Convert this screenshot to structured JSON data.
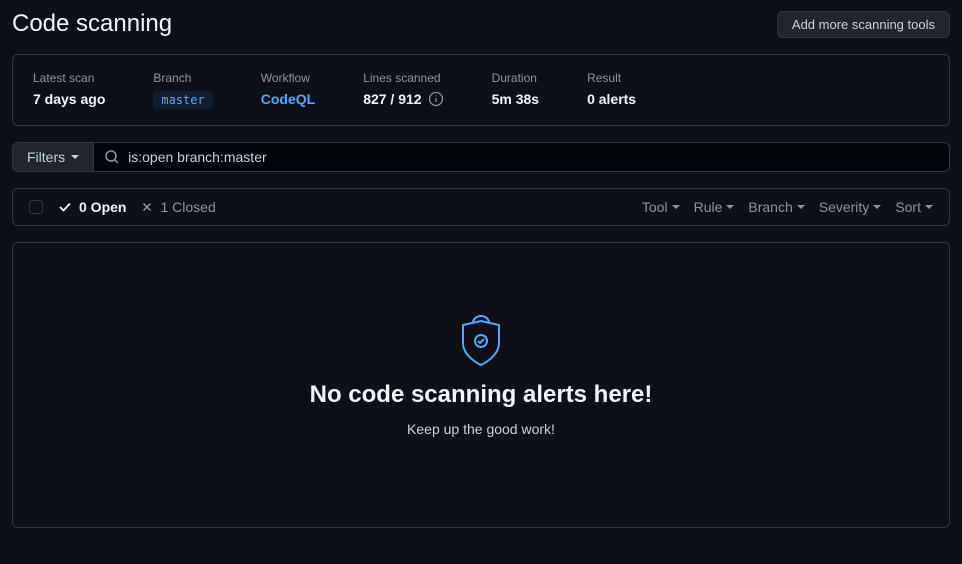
{
  "header": {
    "title": "Code scanning",
    "add_tools_label": "Add more scanning tools"
  },
  "scan": {
    "latest_scan_label": "Latest scan",
    "latest_scan_value": "7 days ago",
    "branch_label": "Branch",
    "branch_value": "master",
    "workflow_label": "Workflow",
    "workflow_value": "CodeQL",
    "lines_label": "Lines scanned",
    "lines_value": "827 / 912",
    "duration_label": "Duration",
    "duration_value": "5m 38s",
    "result_label": "Result",
    "result_value": "0 alerts"
  },
  "filters": {
    "filters_label": "Filters",
    "search_value": "is:open branch:master"
  },
  "list_header": {
    "open_label": "0 Open",
    "closed_label": "1 Closed",
    "dd_tool": "Tool",
    "dd_rule": "Rule",
    "dd_branch": "Branch",
    "dd_severity": "Severity",
    "dd_sort": "Sort"
  },
  "empty": {
    "title": "No code scanning alerts here!",
    "subtitle": "Keep up the good work!"
  }
}
